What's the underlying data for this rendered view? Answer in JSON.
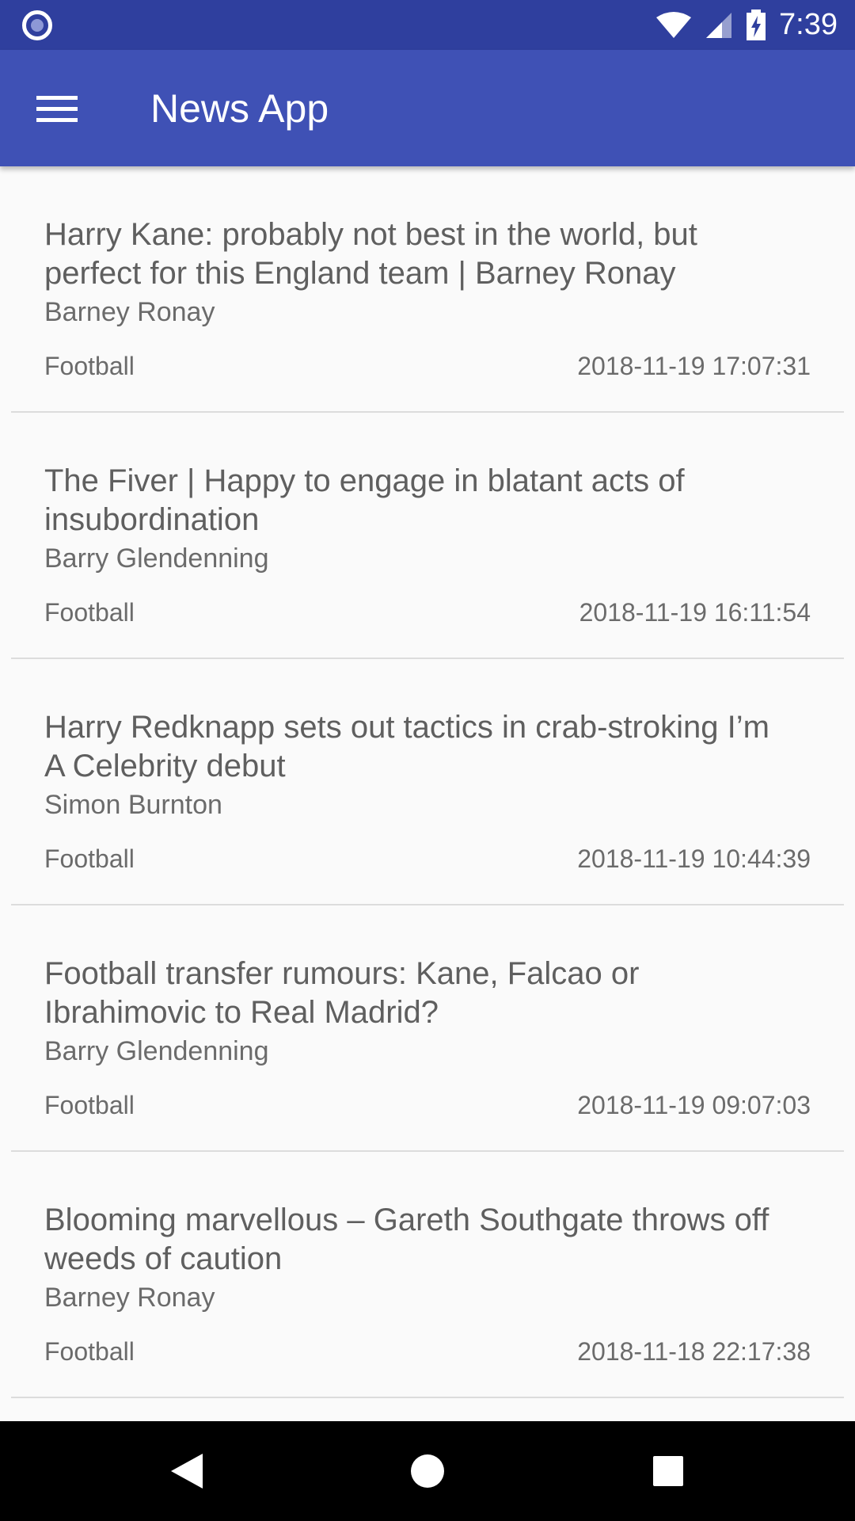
{
  "status_bar": {
    "time": "7:39",
    "left_icon": "notification-dot-icon",
    "icons": [
      "wifi-icon",
      "cell-signal-icon",
      "battery-charging-icon"
    ]
  },
  "app_bar": {
    "title": "News App",
    "menu_icon": "hamburger-menu-icon",
    "color": "#3f51b5"
  },
  "articles": [
    {
      "title": "Harry Kane: probably not best in the world, but perfect for this England team | Barney Ronay",
      "author": "Barney Ronay",
      "section": "Football",
      "date": "2018-11-19 17:07:31"
    },
    {
      "title": "The Fiver | Happy to engage in blatant acts of insubordination",
      "author": "Barry Glendenning",
      "section": "Football",
      "date": "2018-11-19 16:11:54"
    },
    {
      "title": "Harry Redknapp sets out tactics in crab-stroking I’m A Celebrity debut",
      "author": "Simon Burnton",
      "section": "Football",
      "date": "2018-11-19 10:44:39"
    },
    {
      "title": "Football transfer rumours: Kane, Falcao or Ibrahimovic to Real Madrid?",
      "author": "Barry Glendenning",
      "section": "Football",
      "date": "2018-11-19 09:07:03"
    },
    {
      "title": "Blooming marvellous – Gareth Southgate throws off weeds of caution",
      "author": "Barney Ronay",
      "section": "Football",
      "date": "2018-11-18 22:17:38"
    }
  ],
  "nav_bar": {
    "back_icon": "back-triangle-icon",
    "home_icon": "home-circle-icon",
    "recents_icon": "recents-square-icon"
  }
}
